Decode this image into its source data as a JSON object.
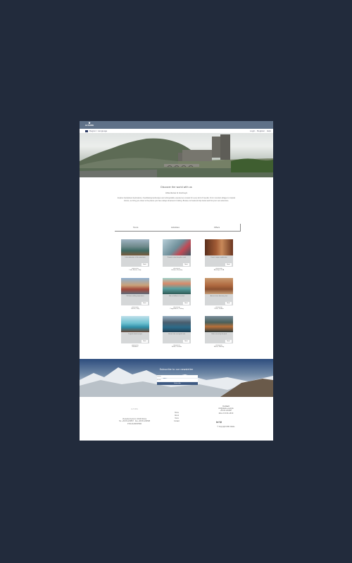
{
  "header": {
    "logo_crest": "⚜",
    "logo_text": "ALTAIRE",
    "language": "Region / Language",
    "right_links": "Login · Register · Help"
  },
  "intro": {
    "title": "Discover the world with us",
    "subtitle": "Adventures & Journeys",
    "body": "Explore handpicked destinations, breathtaking landscapes and unforgettable experiences curated for every kind of traveller. From mountain villages to tropical shores, we bring you closer to the places you have always dreamed of visiting. Browse our featured trips below and find your next adventure."
  },
  "tabs": [
    "Tours",
    "Activities",
    "Offers"
  ],
  "cards": [
    {
      "desc": "Lake adventure in the mountains",
      "button": "Book",
      "price": "★★★★★",
      "tagline": "Lake Braies, Italy"
    },
    {
      "desc": "Sunset cruise along the coast",
      "button": "Book",
      "price": "★★★★★",
      "tagline": "Lofoten, Norway"
    },
    {
      "desc": "Desert canyon exploration",
      "button": "Book",
      "price": "★★★★★",
      "tagline": "Antelope, USA"
    },
    {
      "desc": "Old town walking experience",
      "button": "Book",
      "price": "★★★★★",
      "tagline": "Venice, Italy"
    },
    {
      "desc": "Hot air balloon at sunrise",
      "button": "Book",
      "price": "★★★★★",
      "tagline": "Cappadocia, Turkey"
    },
    {
      "desc": "Ancient ruins discovery tour",
      "button": "Book",
      "price": "★★★★★",
      "tagline": "Petra, Jordan"
    },
    {
      "desc": "Tropical island escape",
      "button": "Book",
      "price": "★★★★★",
      "tagline": "Maldives"
    },
    {
      "desc": "Glacier lake and peaks trek",
      "button": "Book",
      "price": "★★★★★",
      "tagline": "Banff, Canada"
    },
    {
      "desc": "Cabin retreat by the fjord",
      "button": "Book",
      "price": "★★★★★",
      "tagline": "Reine, Norway"
    }
  ],
  "newsletter": {
    "title": "Subscribe to our newsletter",
    "name_placeholder": "Name",
    "email_placeholder": "Email",
    "button": "Subscribe"
  },
  "footer": {
    "brand": "ALTAIRE",
    "address": [
      "Via della Libertà 12, 00100 Roma",
      "Tel. +39 06 1234567 · Fax +39 06 1234568",
      "P.IVA 01234567890"
    ],
    "links": [
      "Home",
      "About",
      "Tours",
      "Contact"
    ],
    "contact_head": "Contact",
    "contact": [
      "info@altaire.example",
      "+39 06 1234567",
      "Mon–Fri 9:00–18:00"
    ],
    "social": "in f ✆",
    "copyright": "© Copyright 2021 Altaire"
  },
  "colors": {
    "background": "#222b3c",
    "topbar": "#5f7188",
    "card_desc": "#d5d7d8",
    "newsletter_button": "#3f5a82"
  }
}
